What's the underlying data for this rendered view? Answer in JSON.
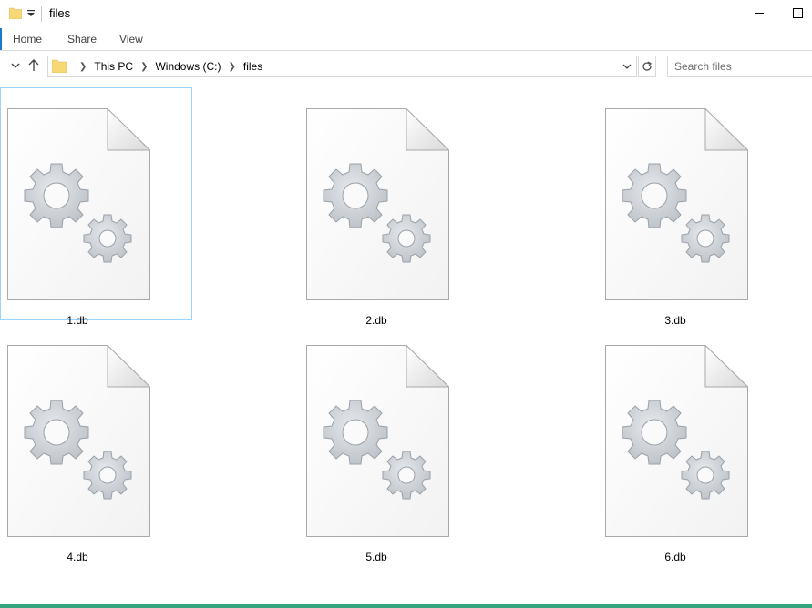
{
  "window": {
    "title": "files"
  },
  "ribbon": {
    "tabs": [
      {
        "label": "Home",
        "active": true
      },
      {
        "label": "Share",
        "active": false
      },
      {
        "label": "View",
        "active": false
      }
    ]
  },
  "address": {
    "crumbs": [
      "This PC",
      "Windows (C:)",
      "files"
    ]
  },
  "search": {
    "placeholder": "Search files"
  },
  "files": [
    {
      "name": "1.db",
      "selected": true
    },
    {
      "name": "2.db",
      "selected": false
    },
    {
      "name": "3.db",
      "selected": false
    },
    {
      "name": "4.db",
      "selected": false
    },
    {
      "name": "5.db",
      "selected": false
    },
    {
      "name": "6.db",
      "selected": false
    }
  ],
  "colors": {
    "accent": "#1979ca",
    "selection_border": "#99d1ff",
    "folder": "#f8d775"
  },
  "icons": {
    "file": "db-file-gears-icon",
    "folder": "folder-icon"
  }
}
